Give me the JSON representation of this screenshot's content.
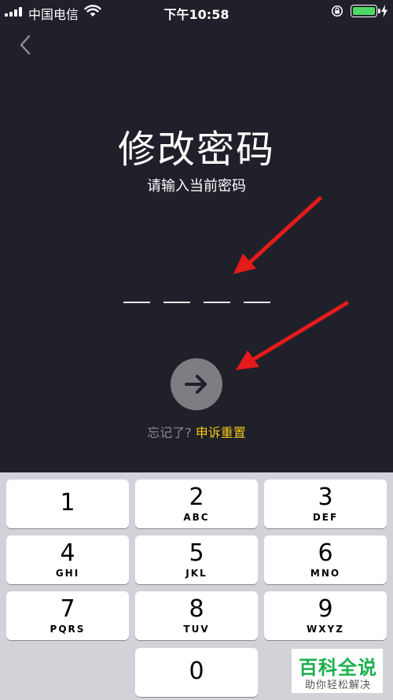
{
  "status_bar": {
    "carrier": "中国电信",
    "time": "下午10:58",
    "battery_level": 1.0,
    "icons": [
      "signal-icon",
      "wifi-icon",
      "rotation-lock-icon",
      "battery-icon",
      "charging-icon"
    ]
  },
  "header": {
    "back_icon": "chevron-left-icon",
    "title": "修改密码",
    "subtitle": "请输入当前密码"
  },
  "pin": {
    "length": 4,
    "entered": ""
  },
  "actions": {
    "next_icon": "arrow-right-icon",
    "forgot_text": "忘记了?",
    "reset_link": "申诉重置"
  },
  "colors": {
    "background": "#1f2029",
    "accent": "#f3c319",
    "annotation_arrow": "#e31b1b",
    "button": "#7d7d82"
  },
  "keypad": {
    "keys": [
      {
        "num": "1",
        "letters": ""
      },
      {
        "num": "2",
        "letters": "ABC"
      },
      {
        "num": "3",
        "letters": "DEF"
      },
      {
        "num": "4",
        "letters": "GHI"
      },
      {
        "num": "5",
        "letters": "JKL"
      },
      {
        "num": "6",
        "letters": "MNO"
      },
      {
        "num": "7",
        "letters": "PQRS"
      },
      {
        "num": "8",
        "letters": "TUV"
      },
      {
        "num": "9",
        "letters": "WXYZ"
      },
      {
        "num": "0",
        "letters": ""
      }
    ]
  },
  "watermark": {
    "main": "百科全说",
    "sub": "助你轻松解决"
  }
}
